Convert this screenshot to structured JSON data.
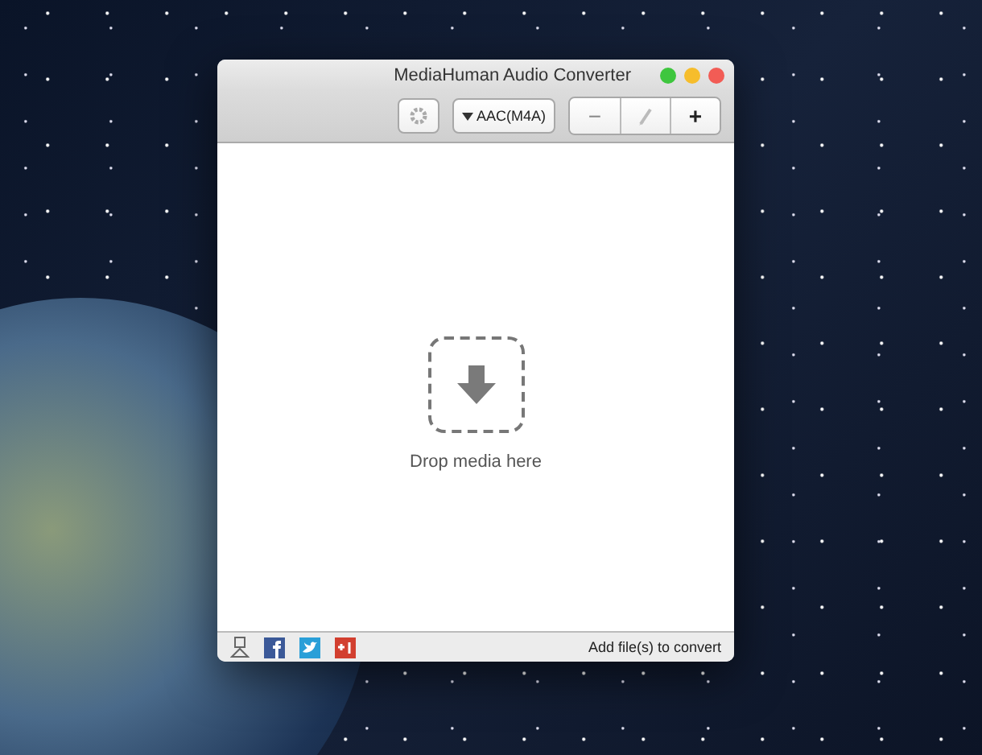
{
  "window": {
    "title": "MediaHuman Audio Converter"
  },
  "toolbar": {
    "format_button": "AAC(M4A)",
    "remove_button": "−",
    "add_button": "+"
  },
  "drop_zone": {
    "label": "Drop media here"
  },
  "status_bar": {
    "text": "Add file(s) to convert"
  }
}
